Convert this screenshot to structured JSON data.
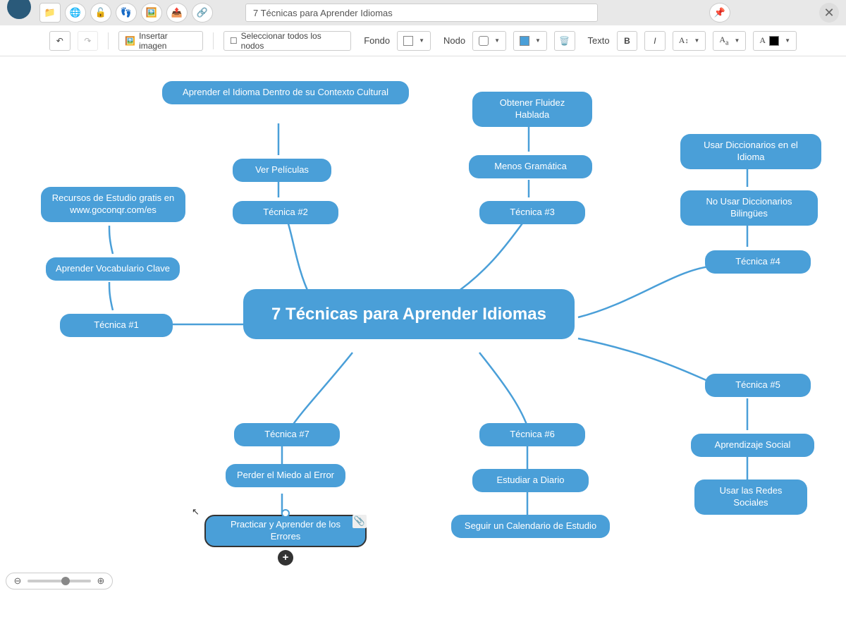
{
  "title": "7 Técnicas para Aprender Idiomas",
  "toolbar": {
    "insert_image": "Insertar imagen",
    "select_all": "Seleccionar todos los nodos",
    "back_label": "Fondo",
    "node_label": "Nodo",
    "text_label": "Texto"
  },
  "mindmap": {
    "central": "7 Técnicas para Aprender Idiomas",
    "t1": {
      "label": "Técnica #1",
      "c1": "Aprender Vocabulario Clave",
      "c2": "Recursos de Estudio gratis en www.goconqr.com/es"
    },
    "t2": {
      "label": "Técnica #2",
      "c1": "Ver Películas",
      "c2": "Aprender el Idioma Dentro de su Contexto Cultural"
    },
    "t3": {
      "label": "Técnica #3",
      "c1": "Menos Gramática",
      "c2": "Obtener Fluidez Hablada"
    },
    "t4": {
      "label": "Técnica #4",
      "c1": "No Usar Diccionarios Bilingües",
      "c2": "Usar Diccionarios en el Idioma"
    },
    "t5": {
      "label": "Técnica #5",
      "c1": "Aprendizaje Social",
      "c2": "Usar las Redes Sociales"
    },
    "t6": {
      "label": "Técnica #6",
      "c1": "Estudiar a Diario",
      "c2": "Seguir un Calendario de Estudio"
    },
    "t7": {
      "label": "Técnica #7",
      "c1": "Perder el Miedo al Error",
      "c2": "Practicar y Aprender de los Errores"
    }
  }
}
